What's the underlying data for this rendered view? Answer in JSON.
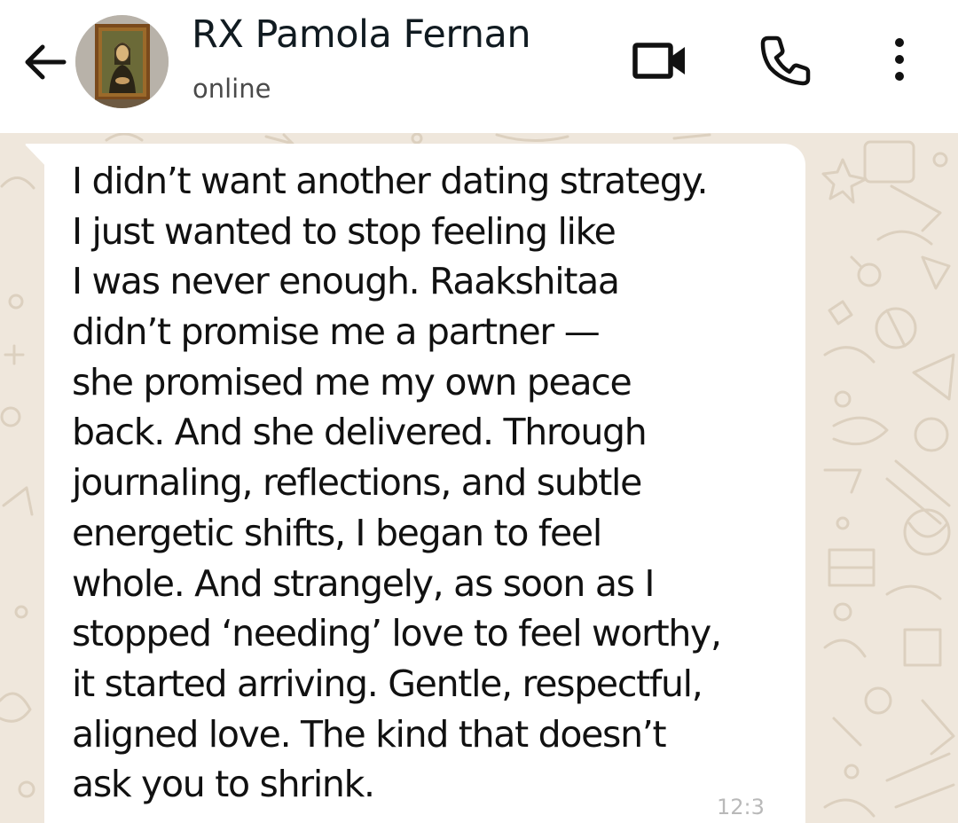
{
  "header": {
    "back_icon": "arrow-left-icon",
    "contact_name": "RX Pamola Fernan",
    "status": "online",
    "video_icon": "video-camera-icon",
    "call_icon": "phone-icon",
    "menu_icon": "more-vertical-icon"
  },
  "message": {
    "lines": [
      "I didn’t want another dating strategy.",
      "I just wanted to stop feeling like",
      "I was never enough. Raakshitaa",
      "didn’t promise me a partner —",
      "she promised me my own peace",
      "back. And she delivered. Through",
      "journaling, reflections, and subtle",
      "energetic shifts, I began to feel",
      "whole. And strangely, as soon as I",
      "stopped ‘needing’ love to feel worthy,",
      "it started arriving. Gentle, respectful,",
      "aligned love. The kind that doesn’t",
      "ask you to shrink."
    ],
    "timestamp": "12:3"
  },
  "colors": {
    "header_bg": "#ffffff",
    "chat_bg": "#efe7dc",
    "bubble_bg": "#ffffff",
    "text": "#111111"
  }
}
